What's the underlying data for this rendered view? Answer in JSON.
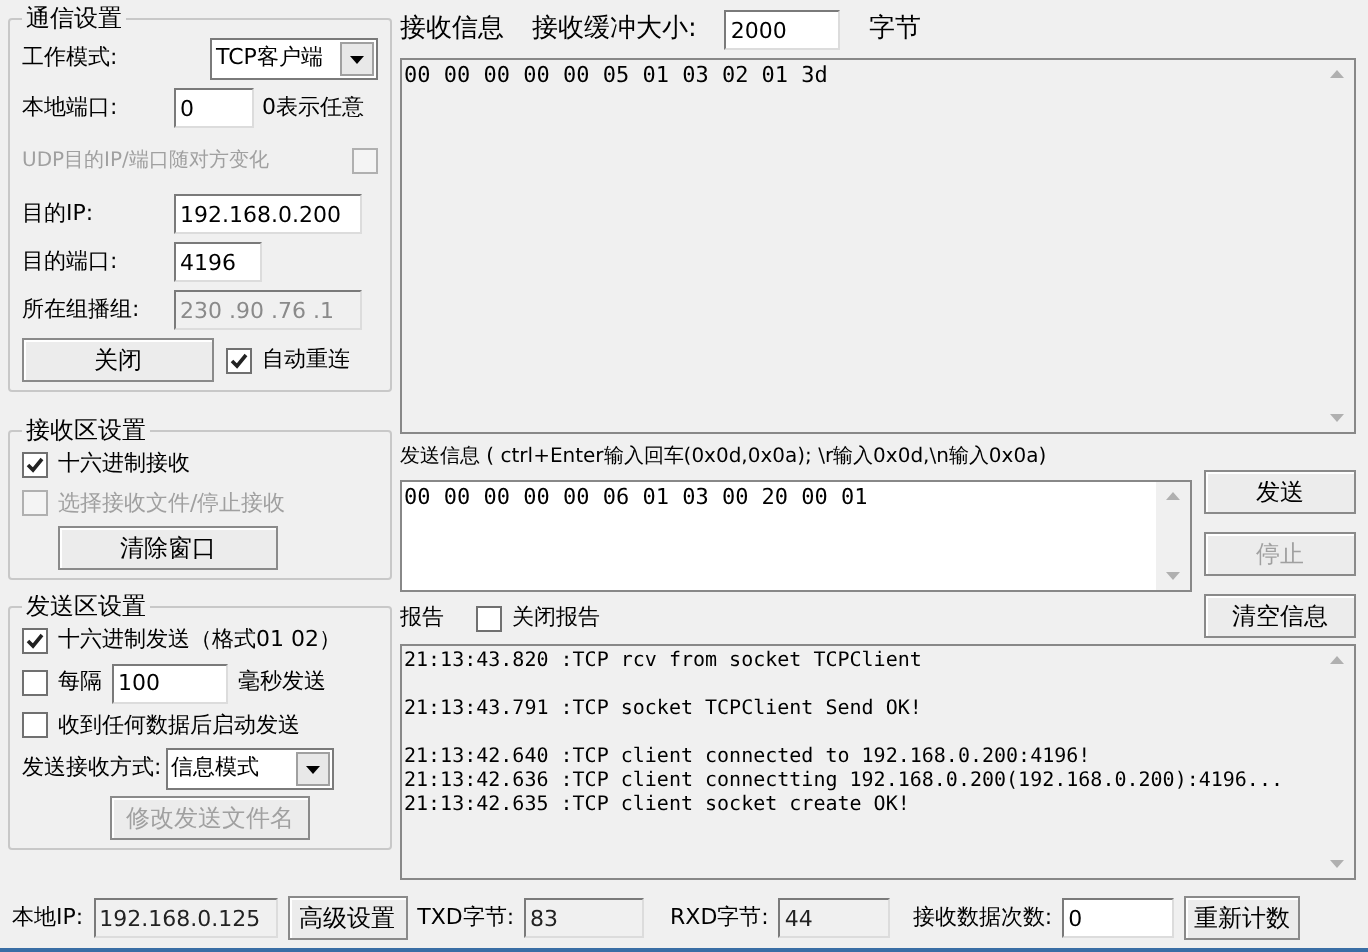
{
  "comm_settings": {
    "title": "通信设置",
    "work_mode": {
      "label": "工作模式:",
      "value": "TCP客户端"
    },
    "local_port": {
      "label": "本地端口:",
      "value": "0",
      "hint": "0表示任意"
    },
    "udp_follow": {
      "label": "UDP目的IP/端口随对方变化",
      "checked": false,
      "disabled": true
    },
    "dest_ip": {
      "label": "目的IP:",
      "value": "192.168.0.200"
    },
    "dest_port": {
      "label": "目的端口:",
      "value": "4196"
    },
    "multicast": {
      "label": "所在组播组:",
      "value": "230 .90 .76 .1",
      "disabled": true
    },
    "close_button": "关闭",
    "auto_reconnect": {
      "label": "自动重连",
      "checked": true
    }
  },
  "receive_settings": {
    "title": "接收区设置",
    "options": [
      {
        "label": "十六进制接收",
        "checked": true,
        "disabled": false
      },
      {
        "label": "选择接收文件/停止接收",
        "checked": false,
        "disabled": true
      }
    ],
    "clear_button": "清除窗口"
  },
  "send_settings": {
    "title": "发送区设置",
    "hex_send": {
      "label": "十六进制发送（格式01 02）",
      "checked": true
    },
    "interval": {
      "label": "每隔",
      "checked": false,
      "value": "100",
      "unit": "毫秒发送"
    },
    "send_on_receive": {
      "label": "收到任何数据后启动发送",
      "checked": false
    },
    "mode": {
      "label": "发送接收方式:",
      "value": "信息模式"
    },
    "rename_button": {
      "label": "修改发送文件名",
      "disabled": true
    }
  },
  "receive": {
    "title": "接收信息",
    "buffer_label": "接收缓冲大小:",
    "buffer_value": "2000",
    "buffer_unit": "字节",
    "content": "00 00 00 00 00 05 01 03 02 01 3d"
  },
  "send": {
    "title": "发送信息 ( ctrl+Enter输入回车(0x0d,0x0a); \\r输入0x0d,\\n输入0x0a)",
    "content": "00 00 00 00 00 06 01 03 00 20 00 01",
    "buttons": [
      {
        "label": "发送",
        "disabled": false
      },
      {
        "label": "停止",
        "disabled": true
      },
      {
        "label": "清空信息",
        "disabled": false
      }
    ]
  },
  "report": {
    "title": "报告",
    "close_report": {
      "label": "关闭报告",
      "checked": false
    },
    "groups": [
      [
        "21:13:43.820 :TCP rcv from socket TCPClient"
      ],
      [
        "21:13:43.791 :TCP socket TCPClient Send OK!"
      ],
      [
        "21:13:42.640 :TCP client connected to 192.168.0.200:4196!",
        "21:13:42.636 :TCP client connectting 192.168.0.200(192.168.0.200):4196...",
        "21:13:42.635 :TCP client socket create OK!"
      ]
    ]
  },
  "status_bar": {
    "local_ip": {
      "label": "本地IP:",
      "value": "192.168.0.125"
    },
    "advanced_button": "高级设置",
    "txd": {
      "label": "TXD字节:",
      "value": "83"
    },
    "rxd": {
      "label": "RXD字节:",
      "value": "44"
    },
    "rx_count": {
      "label": "接收数据次数:",
      "value": "0"
    },
    "reset_button": "重新计数"
  }
}
